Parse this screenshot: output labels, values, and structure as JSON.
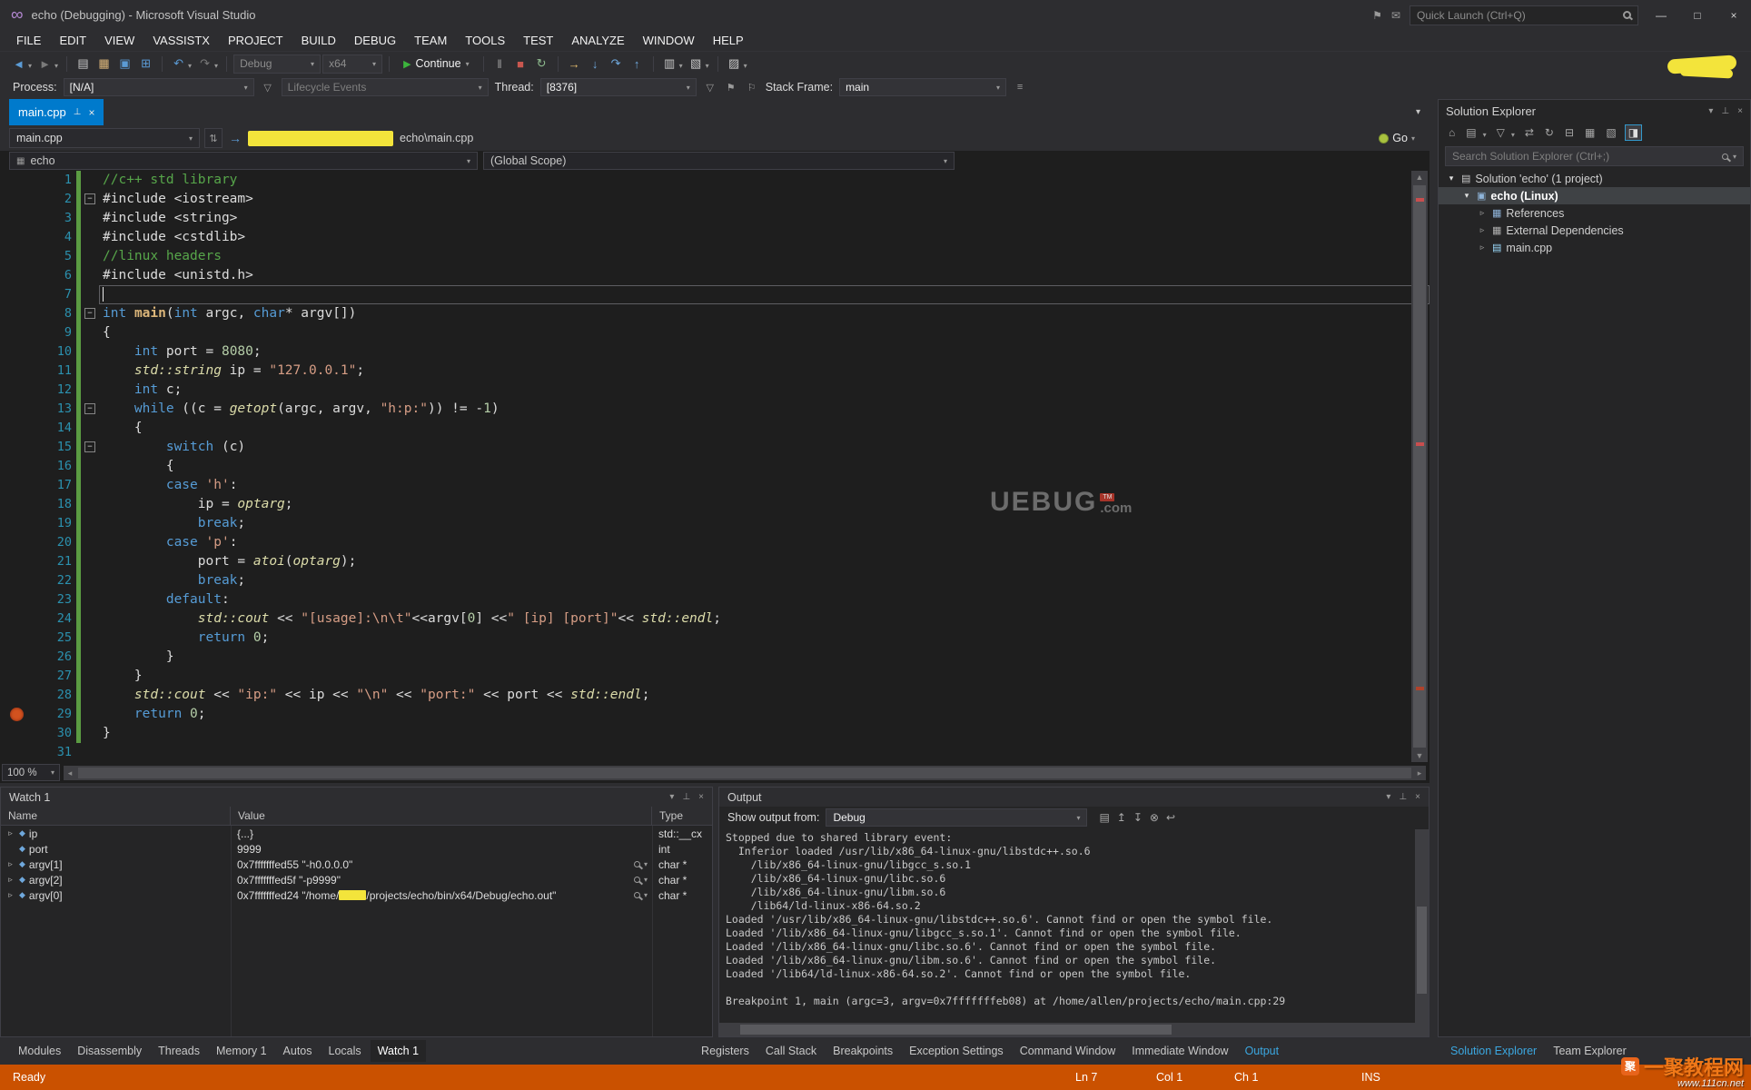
{
  "colors": {
    "accent": "#007ACC",
    "statusbar_debug": "#CA5100",
    "breakpoint": "#D2521F",
    "change_tracking": "#5B9B42",
    "redaction": "#F3E43B"
  },
  "titlebar": {
    "title": "echo (Debugging) - Microsoft Visual Studio",
    "quick_launch": "Quick Launch (Ctrl+Q)"
  },
  "menu": {
    "items": [
      "FILE",
      "EDIT",
      "VIEW",
      "VASSISTX",
      "PROJECT",
      "BUILD",
      "DEBUG",
      "TEAM",
      "TOOLS",
      "TEST",
      "ANALYZE",
      "WINDOW",
      "HELP"
    ]
  },
  "toolbar": {
    "debug_config": "Debug",
    "platform": "x64",
    "continue_label": "Continue",
    "items": [
      {
        "kind": "icon",
        "name": "navigate-backward-icon",
        "glyph": "◄",
        "color": "#5B9BD5",
        "caret": true
      },
      {
        "kind": "icon",
        "name": "navigate-forward-icon",
        "glyph": "►",
        "color": "#7A7A7A",
        "caret": true
      },
      {
        "kind": "sep"
      },
      {
        "kind": "icon",
        "name": "new-file-icon",
        "glyph": "▤",
        "color": "#C8C8C8"
      },
      {
        "kind": "icon",
        "name": "open-file-icon",
        "glyph": "▦",
        "color": "#DCB67A"
      },
      {
        "kind": "icon",
        "name": "save-icon",
        "glyph": "▣",
        "color": "#5B9BD5"
      },
      {
        "kind": "icon",
        "name": "save-all-icon",
        "glyph": "⊞",
        "color": "#5B9BD5"
      },
      {
        "kind": "sep"
      },
      {
        "kind": "icon",
        "name": "undo-icon",
        "glyph": "↶",
        "color": "#5B9BD5",
        "caret": true
      },
      {
        "kind": "icon",
        "name": "redo-icon",
        "glyph": "↷",
        "color": "#7A7A7A",
        "caret": true
      },
      {
        "kind": "sep"
      },
      {
        "kind": "combo",
        "name": "solution-configurations-select",
        "label_key": "debug_config",
        "width": 96
      },
      {
        "kind": "combo",
        "name": "solution-platforms-select",
        "label_key": "platform",
        "width": 66
      },
      {
        "kind": "sep"
      },
      {
        "kind": "continue",
        "name": "continue-button"
      },
      {
        "kind": "sep"
      },
      {
        "kind": "icon",
        "name": "break-all-icon",
        "glyph": "‖",
        "color": "#9E9E9E"
      },
      {
        "kind": "icon",
        "name": "stop-debugging-icon",
        "glyph": "■",
        "color": "#C9574F"
      },
      {
        "kind": "icon",
        "name": "restart-icon",
        "glyph": "↻",
        "color": "#8FBC8F"
      },
      {
        "kind": "sep"
      },
      {
        "kind": "icon",
        "name": "show-next-statement-icon",
        "glyph": "→",
        "color": "#E8C06F"
      },
      {
        "kind": "icon",
        "name": "step-into-icon",
        "glyph": "↓",
        "color": "#6FA8DC"
      },
      {
        "kind": "icon",
        "name": "step-over-icon",
        "glyph": "↷",
        "color": "#6FA8DC"
      },
      {
        "kind": "icon",
        "name": "step-out-icon",
        "glyph": "↑",
        "color": "#6FA8DC"
      },
      {
        "kind": "sep"
      },
      {
        "kind": "icon",
        "name": "intellitrace-icon",
        "glyph": "▥",
        "color": "#C8C8C8",
        "caret": true
      },
      {
        "kind": "icon",
        "name": "diagnostics-icon",
        "glyph": "▧",
        "color": "#C8C8C8",
        "caret": true
      },
      {
        "kind": "sep"
      },
      {
        "kind": "icon",
        "name": "find-icon",
        "glyph": "▨",
        "color": "#C8C8C8",
        "caret": true
      }
    ]
  },
  "debug_location": {
    "process_label": "Process:",
    "process_value": "[N/A]",
    "lifecycle_value": "Lifecycle Events",
    "thread_label": "Thread:",
    "thread_value": "[8376]",
    "stack_frame_label": "Stack Frame:",
    "stack_frame_value": "main"
  },
  "editor": {
    "tab_label": "main.cpp",
    "nav_file": "main.cpp",
    "nav_path": "echo\\main.cpp",
    "go_label": "Go",
    "scope_project": "echo",
    "scope_global": "(Global Scope)",
    "zoom_level": "100 %",
    "current_line": 7,
    "breakpoint_line": 29,
    "fold_lines": [
      2,
      8,
      13,
      15
    ],
    "scroll_marks": [
      {
        "pos": 0.02,
        "color": "#C84E4E"
      },
      {
        "pos": 0.46,
        "color": "#C84E4E"
      },
      {
        "pos": 0.9,
        "color": "#B0422B"
      }
    ],
    "watermark": {
      "main": "UEBUG",
      "badge": "TM",
      "suffix": ".com"
    },
    "code": [
      {
        "n": 1,
        "tk": [
          {
            "t": "//c++ std library",
            "c": "com"
          }
        ]
      },
      {
        "n": 2,
        "tk": [
          {
            "t": "#include <iostream>",
            "c": "d"
          }
        ]
      },
      {
        "n": 3,
        "tk": [
          {
            "t": "#include <string>",
            "c": "d"
          }
        ]
      },
      {
        "n": 4,
        "tk": [
          {
            "t": "#include <cstdlib>",
            "c": "d"
          }
        ]
      },
      {
        "n": 5,
        "tk": [
          {
            "t": "//linux headers",
            "c": "com"
          }
        ]
      },
      {
        "n": 6,
        "tk": [
          {
            "t": "#include <unistd.h>",
            "c": "d"
          }
        ]
      },
      {
        "n": 7,
        "tk": []
      },
      {
        "n": 8,
        "tk": [
          {
            "t": "int",
            "c": "kw"
          },
          {
            "t": " ",
            "c": "d"
          },
          {
            "t": "main",
            "c": "fn"
          },
          {
            "t": "(",
            "c": "d"
          },
          {
            "t": "int",
            "c": "kw"
          },
          {
            "t": " argc, ",
            "c": "d"
          },
          {
            "t": "char",
            "c": "kw"
          },
          {
            "t": "* argv[])",
            "c": "d"
          }
        ]
      },
      {
        "n": 9,
        "tk": [
          {
            "t": "{",
            "c": "d"
          }
        ]
      },
      {
        "n": 10,
        "tk": [
          {
            "t": "    ",
            "c": "d"
          },
          {
            "t": "int",
            "c": "kw"
          },
          {
            "t": " port = ",
            "c": "d"
          },
          {
            "t": "8080",
            "c": "num"
          },
          {
            "t": ";",
            "c": "d"
          }
        ]
      },
      {
        "n": 11,
        "tk": [
          {
            "t": "    ",
            "c": "d"
          },
          {
            "t": "std::string",
            "c": "it"
          },
          {
            "t": " ip = ",
            "c": "d"
          },
          {
            "t": "\"127.0.0.1\"",
            "c": "str"
          },
          {
            "t": ";",
            "c": "d"
          }
        ]
      },
      {
        "n": 12,
        "tk": [
          {
            "t": "    ",
            "c": "d"
          },
          {
            "t": "int",
            "c": "kw"
          },
          {
            "t": " c;",
            "c": "d"
          }
        ]
      },
      {
        "n": 13,
        "tk": [
          {
            "t": "    ",
            "c": "d"
          },
          {
            "t": "while",
            "c": "kw"
          },
          {
            "t": " ((c = ",
            "c": "d"
          },
          {
            "t": "getopt",
            "c": "it"
          },
          {
            "t": "(argc, argv, ",
            "c": "d"
          },
          {
            "t": "\"h:p:\"",
            "c": "str"
          },
          {
            "t": ")) != -",
            "c": "d"
          },
          {
            "t": "1",
            "c": "num"
          },
          {
            "t": ")",
            "c": "d"
          }
        ]
      },
      {
        "n": 14,
        "tk": [
          {
            "t": "    {",
            "c": "d"
          }
        ]
      },
      {
        "n": 15,
        "tk": [
          {
            "t": "        ",
            "c": "d"
          },
          {
            "t": "switch",
            "c": "kw"
          },
          {
            "t": " (c)",
            "c": "d"
          }
        ]
      },
      {
        "n": 16,
        "tk": [
          {
            "t": "        {",
            "c": "d"
          }
        ]
      },
      {
        "n": 17,
        "tk": [
          {
            "t": "        ",
            "c": "d"
          },
          {
            "t": "case",
            "c": "kw"
          },
          {
            "t": " ",
            "c": "d"
          },
          {
            "t": "'h'",
            "c": "str"
          },
          {
            "t": ":",
            "c": "d"
          }
        ]
      },
      {
        "n": 18,
        "tk": [
          {
            "t": "            ip = ",
            "c": "d"
          },
          {
            "t": "optarg",
            "c": "it"
          },
          {
            "t": ";",
            "c": "d"
          }
        ]
      },
      {
        "n": 19,
        "tk": [
          {
            "t": "            ",
            "c": "d"
          },
          {
            "t": "break",
            "c": "kw"
          },
          {
            "t": ";",
            "c": "d"
          }
        ]
      },
      {
        "n": 20,
        "tk": [
          {
            "t": "        ",
            "c": "d"
          },
          {
            "t": "case",
            "c": "kw"
          },
          {
            "t": " ",
            "c": "d"
          },
          {
            "t": "'p'",
            "c": "str"
          },
          {
            "t": ":",
            "c": "d"
          }
        ]
      },
      {
        "n": 21,
        "tk": [
          {
            "t": "            port = ",
            "c": "d"
          },
          {
            "t": "atoi",
            "c": "it"
          },
          {
            "t": "(",
            "c": "d"
          },
          {
            "t": "optarg",
            "c": "it"
          },
          {
            "t": ");",
            "c": "d"
          }
        ]
      },
      {
        "n": 22,
        "tk": [
          {
            "t": "            ",
            "c": "d"
          },
          {
            "t": "break",
            "c": "kw"
          },
          {
            "t": ";",
            "c": "d"
          }
        ]
      },
      {
        "n": 23,
        "tk": [
          {
            "t": "        ",
            "c": "d"
          },
          {
            "t": "default",
            "c": "kw"
          },
          {
            "t": ":",
            "c": "d"
          }
        ]
      },
      {
        "n": 24,
        "tk": [
          {
            "t": "            ",
            "c": "d"
          },
          {
            "t": "std::cout",
            "c": "it"
          },
          {
            "t": " << ",
            "c": "d"
          },
          {
            "t": "\"[usage]:\\n\\t\"",
            "c": "str"
          },
          {
            "t": "<<argv[",
            "c": "d"
          },
          {
            "t": "0",
            "c": "num"
          },
          {
            "t": "] <<",
            "c": "d"
          },
          {
            "t": "\" [ip] [port]\"",
            "c": "str"
          },
          {
            "t": "<< ",
            "c": "d"
          },
          {
            "t": "std::endl",
            "c": "it"
          },
          {
            "t": ";",
            "c": "d"
          }
        ]
      },
      {
        "n": 25,
        "tk": [
          {
            "t": "            ",
            "c": "d"
          },
          {
            "t": "return",
            "c": "kw"
          },
          {
            "t": " ",
            "c": "d"
          },
          {
            "t": "0",
            "c": "num"
          },
          {
            "t": ";",
            "c": "d"
          }
        ]
      },
      {
        "n": 26,
        "tk": [
          {
            "t": "        }",
            "c": "d"
          }
        ]
      },
      {
        "n": 27,
        "tk": [
          {
            "t": "    }",
            "c": "d"
          }
        ]
      },
      {
        "n": 28,
        "tk": [
          {
            "t": "    ",
            "c": "d"
          },
          {
            "t": "std::cout",
            "c": "it"
          },
          {
            "t": " << ",
            "c": "d"
          },
          {
            "t": "\"ip:\"",
            "c": "str"
          },
          {
            "t": " << ip << ",
            "c": "d"
          },
          {
            "t": "\"\\n\"",
            "c": "str"
          },
          {
            "t": " << ",
            "c": "d"
          },
          {
            "t": "\"port:\"",
            "c": "str"
          },
          {
            "t": " << port << ",
            "c": "d"
          },
          {
            "t": "std::endl",
            "c": "it"
          },
          {
            "t": ";",
            "c": "d"
          }
        ]
      },
      {
        "n": 29,
        "tk": [
          {
            "t": "    ",
            "c": "d"
          },
          {
            "t": "return",
            "c": "kw"
          },
          {
            "t": " ",
            "c": "d"
          },
          {
            "t": "0",
            "c": "num"
          },
          {
            "t": ";",
            "c": "d"
          }
        ]
      },
      {
        "n": 30,
        "tk": [
          {
            "t": "}",
            "c": "d"
          }
        ]
      },
      {
        "n": 31,
        "tk": []
      }
    ]
  },
  "watch": {
    "title": "Watch 1",
    "columns": [
      "Name",
      "Value",
      "Type"
    ],
    "rows": [
      {
        "name": "ip",
        "value": "{...}",
        "type": "std::__cx",
        "expandable": true,
        "magnifier": false,
        "redacted": false
      },
      {
        "name": "port",
        "value": "9999",
        "type": "int",
        "expandable": false,
        "magnifier": false,
        "redacted": false
      },
      {
        "name": "argv[1]",
        "value": "0x7fffffffed55 \"-h0.0.0.0\"",
        "type": "char *",
        "expandable": true,
        "magnifier": true,
        "redacted": false
      },
      {
        "name": "argv[2]",
        "value": "0x7fffffffed5f \"-p9999\"",
        "type": "char *",
        "expandable": true,
        "magnifier": true,
        "redacted": false
      },
      {
        "name": "argv[0]",
        "value_prefix": "0x7fffffffed24 \"/home/",
        "value_suffix": "/projects/echo/bin/x64/Debug/echo.out\"",
        "type": "char *",
        "expandable": true,
        "magnifier": true,
        "redacted": true
      }
    ]
  },
  "output": {
    "title": "Output",
    "from_label": "Show output from:",
    "source": "Debug",
    "icons": [
      {
        "name": "find-message-icon",
        "glyph": "▤"
      },
      {
        "name": "goto-previous-message-icon",
        "glyph": "↥"
      },
      {
        "name": "goto-next-message-icon",
        "glyph": "↧"
      },
      {
        "name": "clear-all-icon",
        "glyph": "⊗"
      },
      {
        "name": "word-wrap-icon",
        "glyph": "↩"
      }
    ],
    "lines": [
      "Stopped due to shared library event:",
      "  Inferior loaded /usr/lib/x86_64-linux-gnu/libstdc++.so.6",
      "    /lib/x86_64-linux-gnu/libgcc_s.so.1",
      "    /lib/x86_64-linux-gnu/libc.so.6",
      "    /lib/x86_64-linux-gnu/libm.so.6",
      "    /lib64/ld-linux-x86-64.so.2",
      "Loaded '/usr/lib/x86_64-linux-gnu/libstdc++.so.6'. Cannot find or open the symbol file.",
      "Loaded '/lib/x86_64-linux-gnu/libgcc_s.so.1'. Cannot find or open the symbol file.",
      "Loaded '/lib/x86_64-linux-gnu/libc.so.6'. Cannot find or open the symbol file.",
      "Loaded '/lib/x86_64-linux-gnu/libm.so.6'. Cannot find or open the symbol file.",
      "Loaded '/lib64/ld-linux-x86-64.so.2'. Cannot find or open the symbol file.",
      "",
      "Breakpoint 1, main (argc=3, argv=0x7fffffffeb08) at /home/allen/projects/echo/main.cpp:29"
    ]
  },
  "bottom_tabs": {
    "left": [
      "Modules",
      "Disassembly",
      "Threads",
      "Memory 1",
      "Autos",
      "Locals",
      "Watch 1"
    ],
    "left_active": "Watch 1",
    "right": [
      "Registers",
      "Call Stack",
      "Breakpoints",
      "Exception Settings",
      "Command Window",
      "Immediate Window",
      "Output"
    ],
    "right_active": "Output",
    "far": [
      "Solution Explorer",
      "Team Explorer"
    ],
    "far_active": "Solution Explorer"
  },
  "statusbar": {
    "ready": "Ready",
    "line": "Ln 7",
    "column": "Col 1",
    "character": "Ch 1",
    "mode": "INS"
  },
  "solution_explorer": {
    "title": "Solution Explorer",
    "search_placeholder": "Search Solution Explorer (Ctrl+;)",
    "toolbar_icons": [
      {
        "name": "home-icon",
        "glyph": "⌂"
      },
      {
        "name": "switch-views-icon",
        "glyph": "▤",
        "caret": true
      },
      {
        "name": "filter-icon",
        "glyph": "▽",
        "caret": true
      },
      {
        "name": "sync-with-active-document-icon",
        "glyph": "⇄"
      },
      {
        "name": "refresh-icon",
        "glyph": "↻"
      },
      {
        "name": "collapse-all-icon",
        "glyph": "⊟"
      },
      {
        "name": "show-all-files-icon",
        "glyph": "▦"
      },
      {
        "name": "properties-icon",
        "glyph": "▧"
      },
      {
        "name": "preview-selected-items-icon",
        "glyph": "◨",
        "active": true
      }
    ],
    "tree": [
      {
        "label": "Solution 'echo' (1 project)",
        "level": 0,
        "arrow": "expanded",
        "icon": "solution",
        "bold": false,
        "selected": false
      },
      {
        "label": "echo (Linux)",
        "level": 1,
        "arrow": "expanded",
        "icon": "project",
        "bold": true,
        "selected": true
      },
      {
        "label": "References",
        "level": 2,
        "arrow": "collapsed",
        "icon": "references",
        "bold": false,
        "selected": false
      },
      {
        "label": "External Dependencies",
        "level": 2,
        "arrow": "collapsed",
        "icon": "dependencies",
        "bold": false,
        "selected": false
      },
      {
        "label": "main.cpp",
        "level": 2,
        "arrow": "collapsed",
        "icon": "cpp",
        "bold": false,
        "selected": false
      }
    ]
  },
  "site_watermark": {
    "logo": "聚",
    "name": "一聚教程网",
    "url": "www.111cn.net"
  }
}
